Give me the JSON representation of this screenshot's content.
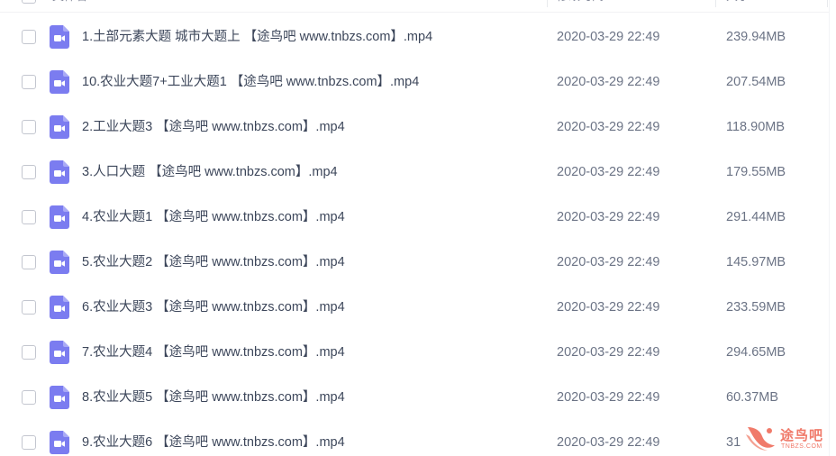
{
  "header": {
    "col_name": "文件名",
    "col_modified": "修改时间",
    "col_size": "大小"
  },
  "files": [
    {
      "name": "1.土部元素大题 城市大题上 【途鸟吧 www.tnbzs.com】.mp4",
      "modified": "2020-03-29 22:49",
      "size": "239.94MB"
    },
    {
      "name": "10.农业大题7+工业大题1 【途鸟吧 www.tnbzs.com】.mp4",
      "modified": "2020-03-29 22:49",
      "size": "207.54MB"
    },
    {
      "name": "2.工业大题3 【途鸟吧 www.tnbzs.com】.mp4",
      "modified": "2020-03-29 22:49",
      "size": "118.90MB"
    },
    {
      "name": "3.人口大题 【途鸟吧 www.tnbzs.com】.mp4",
      "modified": "2020-03-29 22:49",
      "size": "179.55MB"
    },
    {
      "name": "4.农业大题1 【途鸟吧 www.tnbzs.com】.mp4",
      "modified": "2020-03-29 22:49",
      "size": "291.44MB"
    },
    {
      "name": "5.农业大题2 【途鸟吧 www.tnbzs.com】.mp4",
      "modified": "2020-03-29 22:49",
      "size": "145.97MB"
    },
    {
      "name": "6.农业大题3 【途鸟吧 www.tnbzs.com】.mp4",
      "modified": "2020-03-29 22:49",
      "size": "233.59MB"
    },
    {
      "name": "7.农业大题4 【途鸟吧 www.tnbzs.com】.mp4",
      "modified": "2020-03-29 22:49",
      "size": "294.65MB"
    },
    {
      "name": "8.农业大题5 【途鸟吧 www.tnbzs.com】.mp4",
      "modified": "2020-03-29 22:49",
      "size": "60.37MB"
    },
    {
      "name": "9.农业大题6 【途鸟吧 www.tnbzs.com】.mp4",
      "modified": "2020-03-29 22:49",
      "size": "31"
    }
  ],
  "file_icon": "video-file-icon",
  "colors": {
    "icon_accent": "#7b7cf0",
    "text_primary": "#3c465a",
    "text_secondary": "#6b7385",
    "watermark": "#f07a6a"
  },
  "watermark": {
    "title": "途鸟吧",
    "subtitle": "TNBZS.COM"
  }
}
